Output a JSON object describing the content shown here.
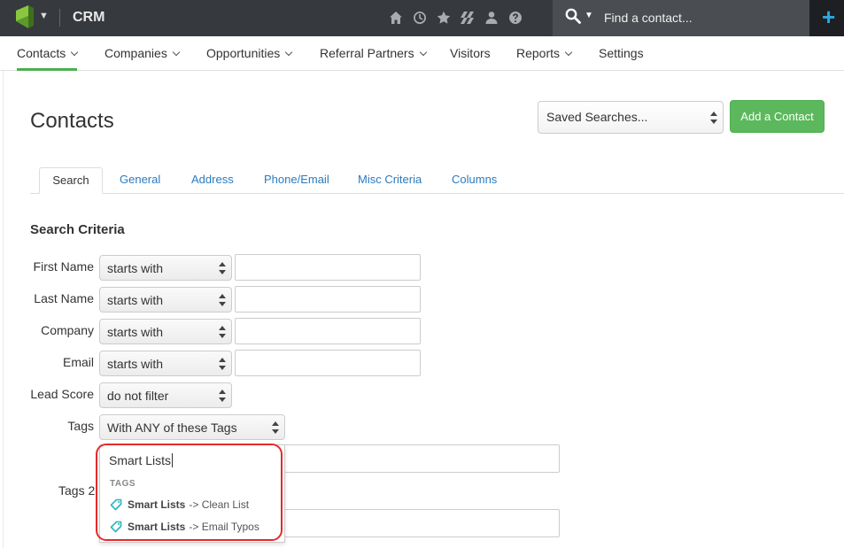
{
  "topbar": {
    "app_name": "CRM",
    "find_placeholder": "Find a contact...",
    "icons": [
      "home-icon",
      "history-icon",
      "star-icon",
      "tags-icon",
      "user-icon",
      "help-icon"
    ],
    "add_symbol": "+"
  },
  "nav": {
    "items": [
      {
        "label": "Contacts",
        "dropdown": true
      },
      {
        "label": "Companies",
        "dropdown": true
      },
      {
        "label": "Opportunities",
        "dropdown": true
      },
      {
        "label": "Referral Partners",
        "dropdown": true
      },
      {
        "label": "Visitors",
        "dropdown": false
      },
      {
        "label": "Reports",
        "dropdown": true
      },
      {
        "label": "Settings",
        "dropdown": false
      }
    ]
  },
  "page": {
    "title": "Contacts",
    "saved_searches": "Saved Searches...",
    "add_contact": "Add a Contact"
  },
  "tabs": [
    "Search",
    "General",
    "Address",
    "Phone/Email",
    "Misc Criteria",
    "Columns"
  ],
  "criteria": {
    "title": "Search Criteria",
    "rows": [
      {
        "label": "First Name",
        "operator": "starts with",
        "value": ""
      },
      {
        "label": "Last Name",
        "operator": "starts with",
        "value": ""
      },
      {
        "label": "Company",
        "operator": "starts with",
        "value": ""
      },
      {
        "label": "Email",
        "operator": "starts with",
        "value": ""
      },
      {
        "label": "Lead Score",
        "operator": "do not filter"
      },
      {
        "label": "Tags",
        "operator": "With ANY of these Tags"
      }
    ],
    "tags2_label": "Tags 2"
  },
  "tag_dropdown": {
    "typed": "Smart Lists",
    "header": "TAGS",
    "items": [
      {
        "bold": "Smart Lists",
        "rest": "-> Clean List"
      },
      {
        "bold": "Smart Lists",
        "rest": "-> Email Typos"
      }
    ]
  },
  "colors": {
    "accent_green": "#5cb85c",
    "link_blue": "#2a7bbf",
    "highlight_red": "#e32b2b",
    "tag_teal": "#2bb3c0"
  }
}
